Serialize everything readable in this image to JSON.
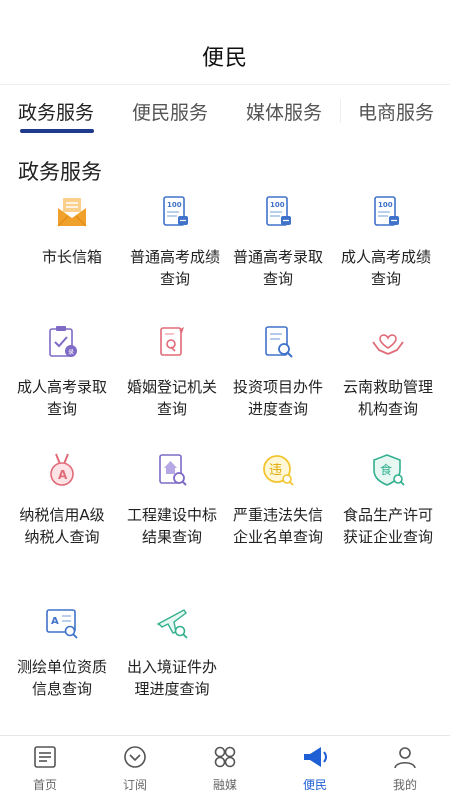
{
  "header": {
    "title": "便民"
  },
  "tabs": [
    {
      "label": "政务服务",
      "active": true
    },
    {
      "label": "便民服务",
      "active": false
    },
    {
      "label": "媒体服务",
      "active": false
    },
    {
      "label": "电商服务",
      "active": false
    }
  ],
  "section": {
    "title": "政务服务"
  },
  "services": [
    {
      "label": "市长信箱",
      "icon": "mail-envelope-icon"
    },
    {
      "label": "普通高考成绩查询",
      "icon": "score-100-icon"
    },
    {
      "label": "普通高考录取查询",
      "icon": "score-100-icon"
    },
    {
      "label": "成人高考成绩查询",
      "icon": "score-100-icon"
    },
    {
      "label": "成人高考录取查询",
      "icon": "clipboard-check-icon"
    },
    {
      "label": "婚姻登记机关查询",
      "icon": "marriage-doc-icon"
    },
    {
      "label": "投资项目办件进度查询",
      "icon": "document-search-icon"
    },
    {
      "label": "云南救助管理机构查询",
      "icon": "heart-hands-icon"
    },
    {
      "label": "纳税信用A级纳税人查询",
      "icon": "medal-a-icon"
    },
    {
      "label": "工程建设中标结果查询",
      "icon": "building-doc-icon"
    },
    {
      "label": "严重违法失信企业名单查询",
      "icon": "violation-badge-icon"
    },
    {
      "label": "食品生产许可获证企业查询",
      "icon": "food-license-icon"
    },
    {
      "label": "测绘单位资质信息查询",
      "icon": "survey-compass-icon"
    },
    {
      "label": "出入境证件办理进度查询",
      "icon": "airplane-search-icon"
    }
  ],
  "nav": [
    {
      "label": "首页",
      "icon": "news-icon",
      "active": false
    },
    {
      "label": "订阅",
      "icon": "subscribe-icon",
      "active": false
    },
    {
      "label": "融媒",
      "icon": "media-grid-icon",
      "active": false
    },
    {
      "label": "便民",
      "icon": "megaphone-icon",
      "active": true
    },
    {
      "label": "我的",
      "icon": "user-icon",
      "active": false
    }
  ],
  "colors": {
    "accent": "#1f3a8a",
    "nav_active": "#1f5fd6",
    "orange": "#f0a12b",
    "blue_icon": "#3f72c9",
    "purple_icon": "#7f6bc6",
    "pink_icon": "#e06a78",
    "yellow_icon": "#f2c531",
    "green_icon": "#33b08f"
  }
}
